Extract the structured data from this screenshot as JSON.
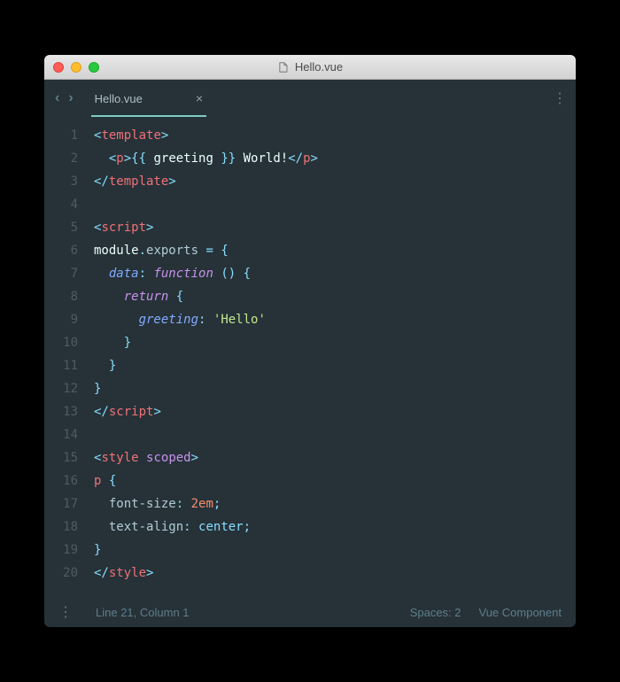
{
  "titlebar": {
    "filename": "Hello.vue"
  },
  "tab": {
    "label": "Hello.vue"
  },
  "lines": [
    {
      "n": "1",
      "segs": [
        [
          "<",
          "c-punc"
        ],
        [
          "template",
          "c-tag"
        ],
        [
          ">",
          "c-punc"
        ]
      ]
    },
    {
      "n": "2",
      "segs": [
        [
          "  ",
          ""
        ],
        [
          "<",
          "c-punc"
        ],
        [
          "p",
          "c-tag"
        ],
        [
          ">",
          "c-punc"
        ],
        [
          "{{ ",
          " c-punc"
        ],
        [
          "greeting",
          "c-text"
        ],
        [
          " }}",
          "c-punc"
        ],
        [
          " World!",
          "c-text"
        ],
        [
          "</",
          "c-punc"
        ],
        [
          "p",
          "c-tag"
        ],
        [
          ">",
          "c-punc"
        ]
      ]
    },
    {
      "n": "3",
      "segs": [
        [
          "</",
          "c-punc"
        ],
        [
          "template",
          "c-tag"
        ],
        [
          ">",
          "c-punc"
        ]
      ]
    },
    {
      "n": "4",
      "segs": [
        [
          "",
          ""
        ]
      ]
    },
    {
      "n": "5",
      "segs": [
        [
          "<",
          "c-punc"
        ],
        [
          "script",
          "c-tag"
        ],
        [
          ">",
          "c-punc"
        ]
      ]
    },
    {
      "n": "6",
      "segs": [
        [
          "module",
          "c-ident"
        ],
        [
          ".",
          "c-punc"
        ],
        [
          "exports",
          "c-prop"
        ],
        [
          " ",
          "c-text"
        ],
        [
          "=",
          "c-punc"
        ],
        [
          " ",
          "c-text"
        ],
        [
          "{",
          "c-punc"
        ]
      ]
    },
    {
      "n": "7",
      "segs": [
        [
          "  ",
          ""
        ],
        [
          "data",
          "c-key"
        ],
        [
          ":",
          "c-punc"
        ],
        [
          " ",
          ""
        ],
        [
          "function",
          "c-fn"
        ],
        [
          " ",
          ""
        ],
        [
          "()",
          "c-punc"
        ],
        [
          " ",
          ""
        ],
        [
          "{",
          "c-punc"
        ]
      ]
    },
    {
      "n": "8",
      "segs": [
        [
          "    ",
          ""
        ],
        [
          "return",
          "c-fn"
        ],
        [
          " ",
          ""
        ],
        [
          "{",
          "c-punc"
        ]
      ]
    },
    {
      "n": "9",
      "segs": [
        [
          "      ",
          ""
        ],
        [
          "greeting",
          "c-key"
        ],
        [
          ":",
          "c-punc"
        ],
        [
          " ",
          ""
        ],
        [
          "'Hello'",
          "c-str"
        ]
      ]
    },
    {
      "n": "10",
      "segs": [
        [
          "    ",
          ""
        ],
        [
          "}",
          "c-punc"
        ]
      ]
    },
    {
      "n": "11",
      "segs": [
        [
          "  ",
          ""
        ],
        [
          "}",
          "c-punc"
        ]
      ]
    },
    {
      "n": "12",
      "segs": [
        [
          "}",
          "c-punc"
        ]
      ]
    },
    {
      "n": "13",
      "segs": [
        [
          "</",
          "c-punc"
        ],
        [
          "script",
          "c-tag"
        ],
        [
          ">",
          "c-punc"
        ]
      ]
    },
    {
      "n": "14",
      "segs": [
        [
          "",
          ""
        ]
      ]
    },
    {
      "n": "15",
      "segs": [
        [
          "<",
          "c-punc"
        ],
        [
          "style",
          "c-tag"
        ],
        [
          " ",
          ""
        ],
        [
          "scoped",
          "c-attr"
        ],
        [
          ">",
          "c-punc"
        ]
      ]
    },
    {
      "n": "16",
      "segs": [
        [
          "p",
          "c-tag"
        ],
        [
          " ",
          ""
        ],
        [
          "{",
          "c-punc"
        ]
      ]
    },
    {
      "n": "17",
      "segs": [
        [
          "  ",
          ""
        ],
        [
          "font-size",
          "c-prop"
        ],
        [
          ":",
          "c-punc"
        ],
        [
          " ",
          ""
        ],
        [
          "2em",
          "c-num"
        ],
        [
          ";",
          "c-punc"
        ]
      ]
    },
    {
      "n": "18",
      "segs": [
        [
          "  ",
          ""
        ],
        [
          "text-align",
          "c-prop"
        ],
        [
          ":",
          "c-punc"
        ],
        [
          " ",
          ""
        ],
        [
          "center",
          "c-val"
        ],
        [
          ";",
          "c-punc"
        ]
      ]
    },
    {
      "n": "19",
      "segs": [
        [
          "}",
          "c-punc"
        ]
      ]
    },
    {
      "n": "20",
      "segs": [
        [
          "</",
          "c-punc"
        ],
        [
          "style",
          "c-tag"
        ],
        [
          ">",
          "c-punc"
        ]
      ]
    }
  ],
  "statusbar": {
    "cursor": "Line 21, Column 1",
    "spaces": "Spaces: 2",
    "syntax": "Vue Component"
  }
}
